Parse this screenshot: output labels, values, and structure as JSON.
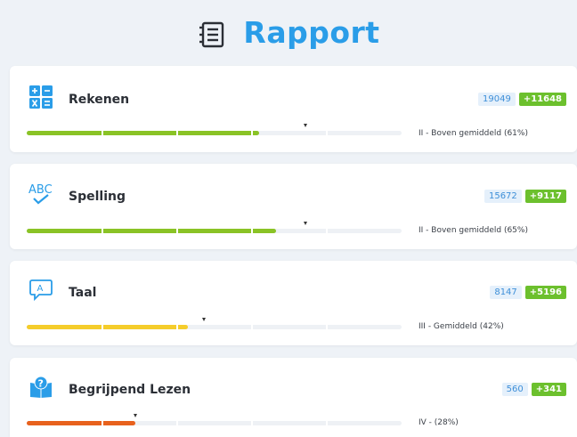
{
  "header": {
    "title": "Rapport",
    "icon": "report-list-icon",
    "color": "#2a9de8"
  },
  "subjects": [
    {
      "id": "rekenen",
      "title": "Rekenen",
      "icon": "math-operators-icon",
      "score": "19049",
      "delta": "+11648",
      "level": "II - Boven gemiddeld (61%)",
      "progress": 0.62,
      "marker": 0.745,
      "bar_color": "#8ac326"
    },
    {
      "id": "spelling",
      "title": "Spelling",
      "icon": "abc-check-icon",
      "score": "15672",
      "delta": "+9117",
      "level": "II - Boven gemiddeld (65%)",
      "progress": 0.665,
      "marker": 0.745,
      "bar_color": "#8ac326"
    },
    {
      "id": "taal",
      "title": "Taal",
      "icon": "speech-bubble-a-icon",
      "score": "8147",
      "delta": "+5196",
      "level": "III - Gemiddeld (42%)",
      "progress": 0.43,
      "marker": 0.475,
      "bar_color": "#f5cd2b"
    },
    {
      "id": "lezen",
      "title": "Begrijpend Lezen",
      "icon": "book-question-icon",
      "score": "560",
      "delta": "+341",
      "level": "IV - (28%)",
      "progress": 0.29,
      "marker": 0.29,
      "bar_color": "#e8611d"
    }
  ]
}
